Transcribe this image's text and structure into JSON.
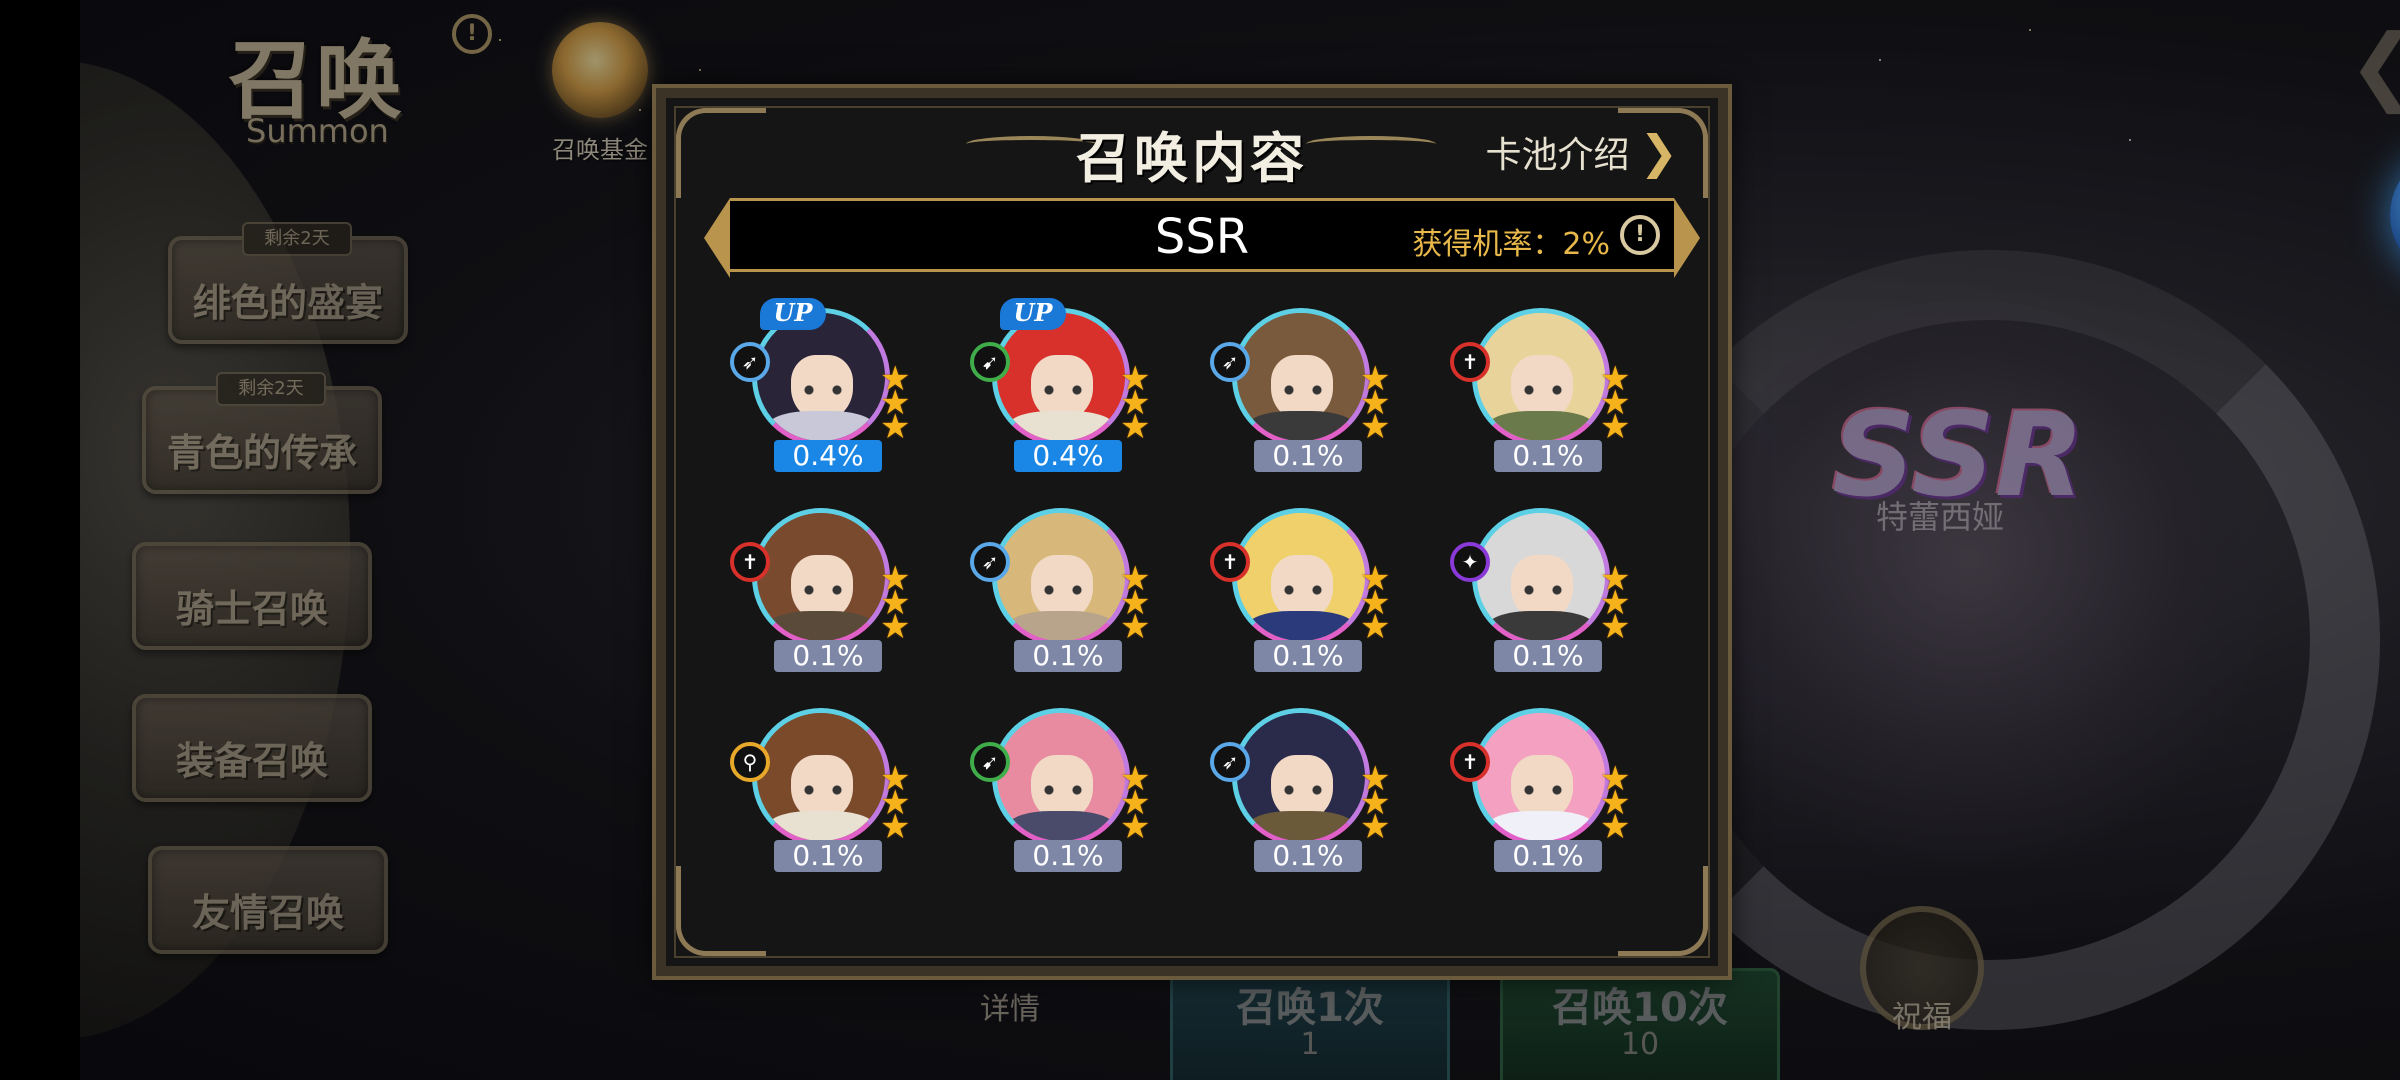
{
  "header": {
    "title_cn": "召唤",
    "title_en": "Summon",
    "fund_label": "召唤基金"
  },
  "menu": [
    {
      "label": "绯色的盛宴",
      "tag": "剩余2天"
    },
    {
      "label": "青色的传承",
      "tag": "剩余2天"
    },
    {
      "label": "骑士召唤",
      "tag": ""
    },
    {
      "label": "装备召唤",
      "tag": ""
    },
    {
      "label": "友情召唤",
      "tag": ""
    }
  ],
  "background": {
    "ssr_text": "SSR",
    "featured_name": "特蕾西娅",
    "detail_label": "详情",
    "bless_label": "祝福",
    "summon1": {
      "label": "召唤1次",
      "cost": "1"
    },
    "summon10": {
      "label": "召唤10次",
      "cost": "10"
    }
  },
  "modal": {
    "title": "召唤内容",
    "pool_intro": "卡池介绍",
    "rarity": "SSR",
    "rate_label": "获得机率：2%",
    "up_tag": "UP",
    "cards": [
      {
        "rate": "0.4%",
        "up": true,
        "class_icon": "spear-icon",
        "class_color": "#5aa8e8",
        "hair": "#2a2438",
        "body": "#c8c8d8",
        "stars": 3
      },
      {
        "rate": "0.4%",
        "up": true,
        "class_icon": "bow-icon",
        "class_color": "#3fae4a",
        "hair": "#d8302a",
        "body": "#e8e0d0",
        "stars": 3
      },
      {
        "rate": "0.1%",
        "up": false,
        "class_icon": "spear-icon",
        "class_color": "#5aa8e8",
        "hair": "#7a5a3c",
        "body": "#3a3a3a",
        "stars": 3
      },
      {
        "rate": "0.1%",
        "up": false,
        "class_icon": "sword-icon",
        "class_color": "#d8302a",
        "hair": "#e8d49a",
        "body": "#6a7a4a",
        "stars": 3
      },
      {
        "rate": "0.1%",
        "up": false,
        "class_icon": "sword-icon",
        "class_color": "#d8302a",
        "hair": "#7a4a2e",
        "body": "#5a4a3a",
        "stars": 3
      },
      {
        "rate": "0.1%",
        "up": false,
        "class_icon": "spear-icon",
        "class_color": "#5aa8e8",
        "hair": "#d8b87a",
        "body": "#b8a48a",
        "stars": 3
      },
      {
        "rate": "0.1%",
        "up": false,
        "class_icon": "sword-icon",
        "class_color": "#d8302a",
        "hair": "#f0d06a",
        "body": "#2a3a7a",
        "stars": 3
      },
      {
        "rate": "0.1%",
        "up": false,
        "class_icon": "magic-icon",
        "class_color": "#8a3ad8",
        "hair": "#d8d8d8",
        "body": "#3a3a3a",
        "stars": 3
      },
      {
        "rate": "0.1%",
        "up": false,
        "class_icon": "staff-icon",
        "class_color": "#e8a82a",
        "hair": "#7a4a2a",
        "body": "#e8e0d0",
        "stars": 3
      },
      {
        "rate": "0.1%",
        "up": false,
        "class_icon": "bow-icon",
        "class_color": "#3fae4a",
        "hair": "#e88aa0",
        "body": "#4a4a6a",
        "stars": 3
      },
      {
        "rate": "0.1%",
        "up": false,
        "class_icon": "spear-icon",
        "class_color": "#5aa8e8",
        "hair": "#2a2a4a",
        "body": "#6a5a3a",
        "stars": 3
      },
      {
        "rate": "0.1%",
        "up": false,
        "class_icon": "sword-icon",
        "class_color": "#d8302a",
        "hair": "#f4a0c0",
        "body": "#f0f0f8",
        "stars": 3
      }
    ]
  }
}
